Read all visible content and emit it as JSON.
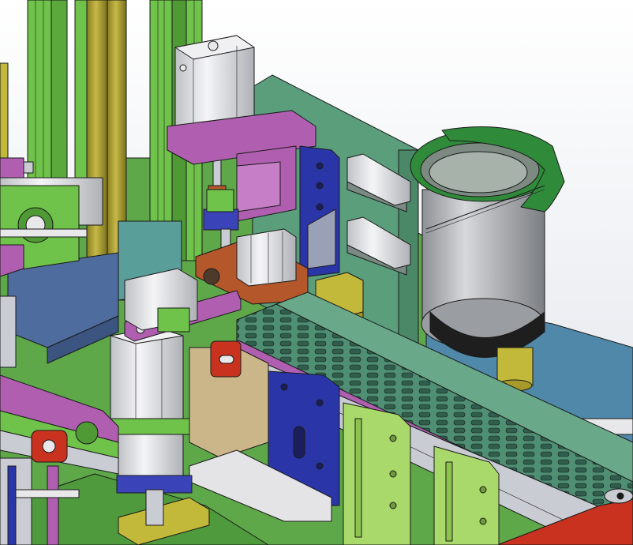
{
  "viewport": {
    "kind": "cad-3d-model-view"
  },
  "colors": {
    "background_top": "#ffffff",
    "background_bottom": "#d9dde6",
    "base_plate": "#5ea84a",
    "frame_green": "#6fc24a",
    "teal_plate": "#5a9e7c",
    "bowl_green": "#2f8a3a",
    "bowl_gray": "#b9bcc0",
    "bowl_ring": "#1e1e1e",
    "cylinder_white": "#e8e8ea",
    "magenta": "#b05fb0",
    "navy": "#2a36a8",
    "brown": "#b4572a",
    "olive": "#a89a2a",
    "red": "#c9321e",
    "slate_blue": "#4f6c9e",
    "light_green_plate": "#a8d96a",
    "steel": "#c9ccd2",
    "khaki": "#cbb68a"
  },
  "parts": [
    {
      "name": "vibratory-bowl-feeder"
    },
    {
      "name": "feed-track-conveyor"
    },
    {
      "name": "pneumatic-cylinder-top"
    },
    {
      "name": "gripper-assembly"
    },
    {
      "name": "linear-rail-module"
    },
    {
      "name": "support-frame"
    }
  ]
}
